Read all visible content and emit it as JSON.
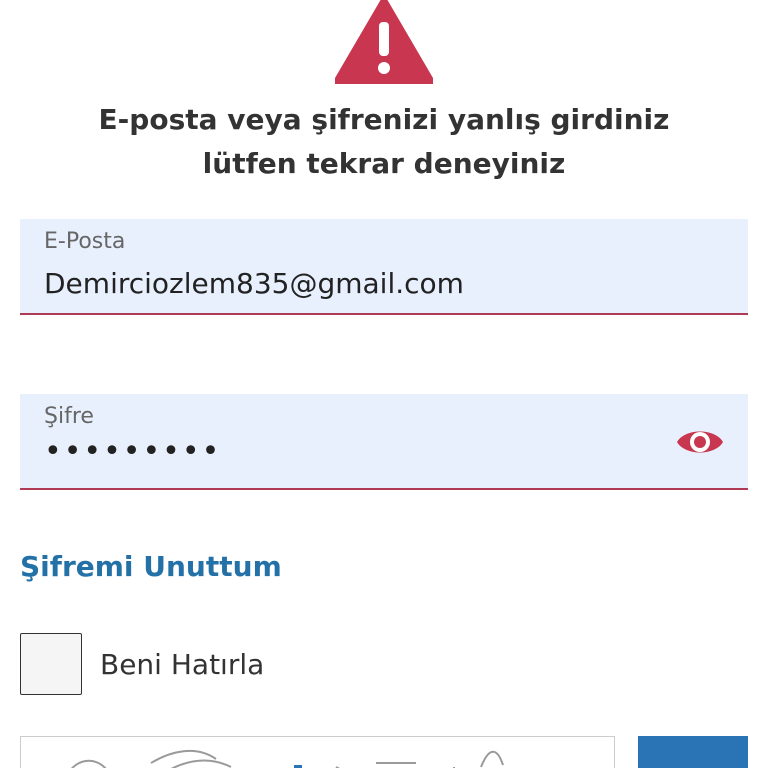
{
  "error": {
    "icon": "warning-triangle-icon",
    "message": "E-posta veya şifrenizi yanlış girdiniz lütfen tekrar deneyiniz"
  },
  "email_field": {
    "label": "E-Posta",
    "value": "Demirciozlem835@gmail.com"
  },
  "password_field": {
    "label": "Şifre",
    "masked_value": "•••••••••",
    "toggle_icon": "eye-icon"
  },
  "forgot_password": {
    "label": "Şifremi Unuttum"
  },
  "remember_me": {
    "label": "Beni Hatırla",
    "checked": false
  },
  "colors": {
    "accent_red": "#c8374f",
    "field_background": "#e8f0fe",
    "field_underline": "#b03a55",
    "link_blue": "#2471a8",
    "button_blue": "#2a73b4"
  }
}
